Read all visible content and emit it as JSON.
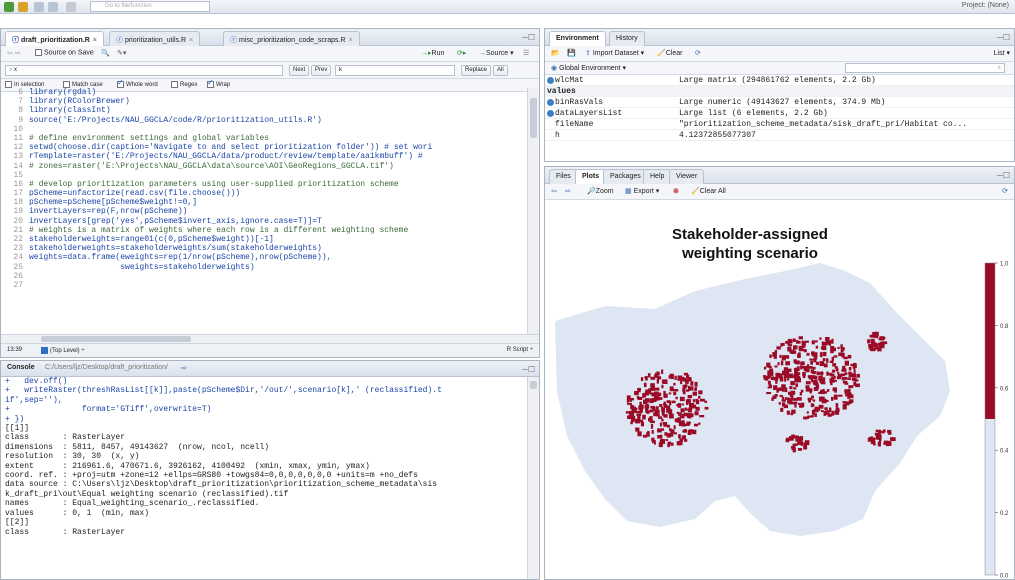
{
  "app": {
    "go_to_placeholder": "Go to file/function",
    "project_label": "Project: (None)"
  },
  "editor": {
    "tabs": [
      {
        "label": "draft_prioritization.R",
        "active": true
      },
      {
        "label": "prioritization_utils.R",
        "active": false
      },
      {
        "label": "misc_prioritization_code_scraps.R",
        "active": false
      }
    ],
    "source_on_save": "Source on Save",
    "run_label": "Run",
    "source_label": "Source",
    "find_value": "x",
    "replace_value": "k",
    "next_label": "Next",
    "prev_label": "Prev",
    "replace_label": "Replace",
    "all_label": "All",
    "find_options": [
      "In selection",
      "Match case",
      "Whole word",
      "Regex",
      "Wrap"
    ],
    "lines": [
      {
        "n": "6",
        "text": "library(rgdal)"
      },
      {
        "n": "7",
        "text": "library(RColorBrewer)"
      },
      {
        "n": "8",
        "text": "library(classInt)"
      },
      {
        "n": "9",
        "text": "source('E:/Projects/NAU_GGCLA/code/R/prioritization_utils.R')"
      },
      {
        "n": "10",
        "text": ""
      },
      {
        "n": "11",
        "text": "# define environment settings and global variables"
      },
      {
        "n": "12",
        "text": "setwd(choose.dir(caption='Navigate to and select prioritization folder')) # set wori"
      },
      {
        "n": "13",
        "text": "rTemplate=raster('E:/Projects/NAU_GGCLA/data/product/review/template/aa1kmbuff') # "
      },
      {
        "n": "14",
        "text": "# zones=raster('E:\\Projects\\NAU_GGCLA\\data\\source\\AOI\\GeoRegions_GGCLA.tif')"
      },
      {
        "n": "15",
        "text": ""
      },
      {
        "n": "16",
        "text": "# develop prioritization parameters using user-supplied prioritization scheme"
      },
      {
        "n": "17",
        "text": "pScheme=unfactorize(read.csv(file.choose()))"
      },
      {
        "n": "18",
        "text": "pScheme=pScheme[pScheme$weight!=0,]"
      },
      {
        "n": "19",
        "text": "invertLayers=rep(F,nrow(pScheme))"
      },
      {
        "n": "20",
        "text": "invertLayers[grep('yes',pScheme$invert_axis,ignore.case=T)]=T"
      },
      {
        "n": "21",
        "text": "# weights is a matrix of weights where each row is a different weighting scheme"
      },
      {
        "n": "22",
        "text": "stakeholderweights=range01(c(0,pScheme$weight))[-1]"
      },
      {
        "n": "23",
        "text": "stakeholderweights=stakeholderweights/sum(stakeholderweights)"
      },
      {
        "n": "24",
        "text": "weights=data.frame(eweights=rep(1/nrow(pScheme),nrow(pScheme)),"
      },
      {
        "n": "25",
        "text": "                   sweights=stakeholderweights)"
      },
      {
        "n": "26",
        "text": ""
      },
      {
        "n": "27",
        "text": ""
      }
    ],
    "status_position": "13:39",
    "status_scope": "(Top Level) ÷",
    "status_type": "R Script ÷"
  },
  "console": {
    "title": "Console",
    "path": "C:/Users/ljz/Desktop/draft_prioritization/",
    "lines": [
      {
        "text": "+   dev.off()",
        "cmd": true
      },
      {
        "text": "+   writeRaster(threshRasList[[k]],paste(pScheme$Dir,'/out/',scenario[k],' (reclassified).t",
        "cmd": true
      },
      {
        "text": "if',sep=''),",
        "cmd": true
      },
      {
        "text": "+               format='GTiff',overwrite=T)",
        "cmd": true
      },
      {
        "text": "+ })",
        "cmd": true
      },
      {
        "text": "[[1]]",
        "cmd": false
      },
      {
        "text": "class       : RasterLayer",
        "cmd": false
      },
      {
        "text": "dimensions  : 5811, 8457, 49143627  (nrow, ncol, ncell)",
        "cmd": false
      },
      {
        "text": "resolution  : 30, 30  (x, y)",
        "cmd": false
      },
      {
        "text": "extent      : 216961.6, 470671.6, 3926162, 4100492  (xmin, xmax, ymin, ymax)",
        "cmd": false
      },
      {
        "text": "coord. ref. : +proj=utm +zone=12 +ellps=GRS80 +towgs84=0,0,0,0,0,0,0 +units=m +no_defs",
        "cmd": false
      },
      {
        "text": "data source : C:\\Users\\ljz\\Desktop\\draft_prioritization\\prioritization_scheme_metadata\\sis",
        "cmd": false
      },
      {
        "text": "k_draft_pri\\out\\Equal weighting scenario (reclassified).tif",
        "cmd": false
      },
      {
        "text": "names       : Equal_weighting_scenario_.reclassified.",
        "cmd": false
      },
      {
        "text": "values      : 0, 1  (min, max)",
        "cmd": false
      },
      {
        "text": "",
        "cmd": false
      },
      {
        "text": "",
        "cmd": false
      },
      {
        "text": "[[2]]",
        "cmd": false
      },
      {
        "text": "class       : RasterLayer",
        "cmd": false
      }
    ]
  },
  "environment": {
    "tabs": [
      {
        "label": "Environment",
        "active": true
      },
      {
        "label": "History",
        "active": false
      }
    ],
    "import_label": "Import Dataset",
    "clear_label": "Clear",
    "list_label": "List",
    "scope_label": "Global Environment",
    "rows": [
      {
        "name": "wlcMat",
        "value": "Large matrix (294861762 elements, 2.2 Gb)",
        "dot": true
      },
      {
        "name": "values",
        "value": "",
        "header": true
      },
      {
        "name": "binRasVals",
        "value": "Large numeric (49143627 elements, 374.9 Mb)",
        "dot": true
      },
      {
        "name": "dataLayersList",
        "value": "Large list (6 elements, 2.2 Gb)",
        "dot": true
      },
      {
        "name": "fileName",
        "value": "\"prioritization_scheme_metadata/sisk_draft_pri/Habitat co...",
        "dot": false
      },
      {
        "name": "h",
        "value": "4.12372855077307",
        "dot": false
      }
    ]
  },
  "plots_pane": {
    "tabs": [
      {
        "label": "Files",
        "active": false
      },
      {
        "label": "Plots",
        "active": true
      },
      {
        "label": "Packages",
        "active": false
      },
      {
        "label": "Help",
        "active": false
      },
      {
        "label": "Viewer",
        "active": false
      }
    ],
    "zoom_label": "Zoom",
    "export_label": "Export",
    "clear_all_label": "Clear All"
  },
  "chart_data": {
    "type": "heatmap",
    "title": "Stakeholder-assigned weighting scenario",
    "legend_ticks": [
      "1.0",
      "0.8",
      "0.6",
      "0.4",
      "0.2",
      "0.0"
    ],
    "legend_range": [
      0,
      1
    ],
    "legend_threshold": 0.5,
    "low_color": "#dde6f2",
    "high_color": "#9b0b26"
  }
}
